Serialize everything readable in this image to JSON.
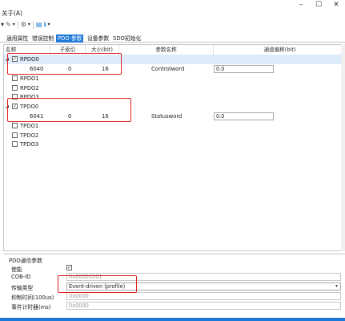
{
  "window": {
    "minimize": "–",
    "maximize": "☐",
    "close": "✕"
  },
  "menubar": {
    "about": "关于(A)"
  },
  "toolbar": {
    "icons": [
      "wand-icon",
      "gear-icon",
      "document-icon",
      "info-icon"
    ]
  },
  "tabs": [
    {
      "label": "通用属性"
    },
    {
      "label": "错误控制"
    },
    {
      "label": "PDO 参数",
      "active": true
    },
    {
      "label": "设备参数"
    },
    {
      "label": "SDO初始化"
    }
  ],
  "tree": {
    "headers": {
      "name": "名称",
      "subindex": "子索引",
      "size": "大小(bit)",
      "param_name": "参数名称",
      "comm_offset": "通道偏移(bit)"
    },
    "rows": [
      {
        "label": "RPDO0",
        "checked": true,
        "expanded": true,
        "selected": true
      },
      {
        "index": "6040",
        "sub": "0",
        "size": "16",
        "param": "Controlword",
        "offset": "0.0"
      },
      {
        "label": "RPDO1",
        "checked": false
      },
      {
        "label": "RPDO2",
        "checked": false
      },
      {
        "label": "RPDO3",
        "checked": false
      },
      {
        "label": "TPDO0",
        "checked": true,
        "expanded": true
      },
      {
        "index": "6041",
        "sub": "0",
        "size": "16",
        "param": "Statusword",
        "offset": "0.0"
      },
      {
        "label": "TPDO1",
        "checked": false
      },
      {
        "label": "TPDO2",
        "checked": false
      },
      {
        "label": "TPDO3",
        "checked": false
      }
    ]
  },
  "pdo_params": {
    "group_title": "PDO通信参数",
    "enable_label": "使能",
    "enable_checked": true,
    "cobid_label": "COB-ID",
    "cobid_value": "0x00000201",
    "trans_type_label": "传输类型",
    "trans_type_value": "Event-driven (profile)",
    "inhibit_label": "抑制时间(100us)",
    "inhibit_value": "0x0000",
    "event_timer_label": "事件计时器(ms)",
    "event_timer_value": "0x0000"
  },
  "colors": {
    "accent": "#1e78d7",
    "highlight_box": "#e02020",
    "selected_row": "#ddebfa"
  }
}
